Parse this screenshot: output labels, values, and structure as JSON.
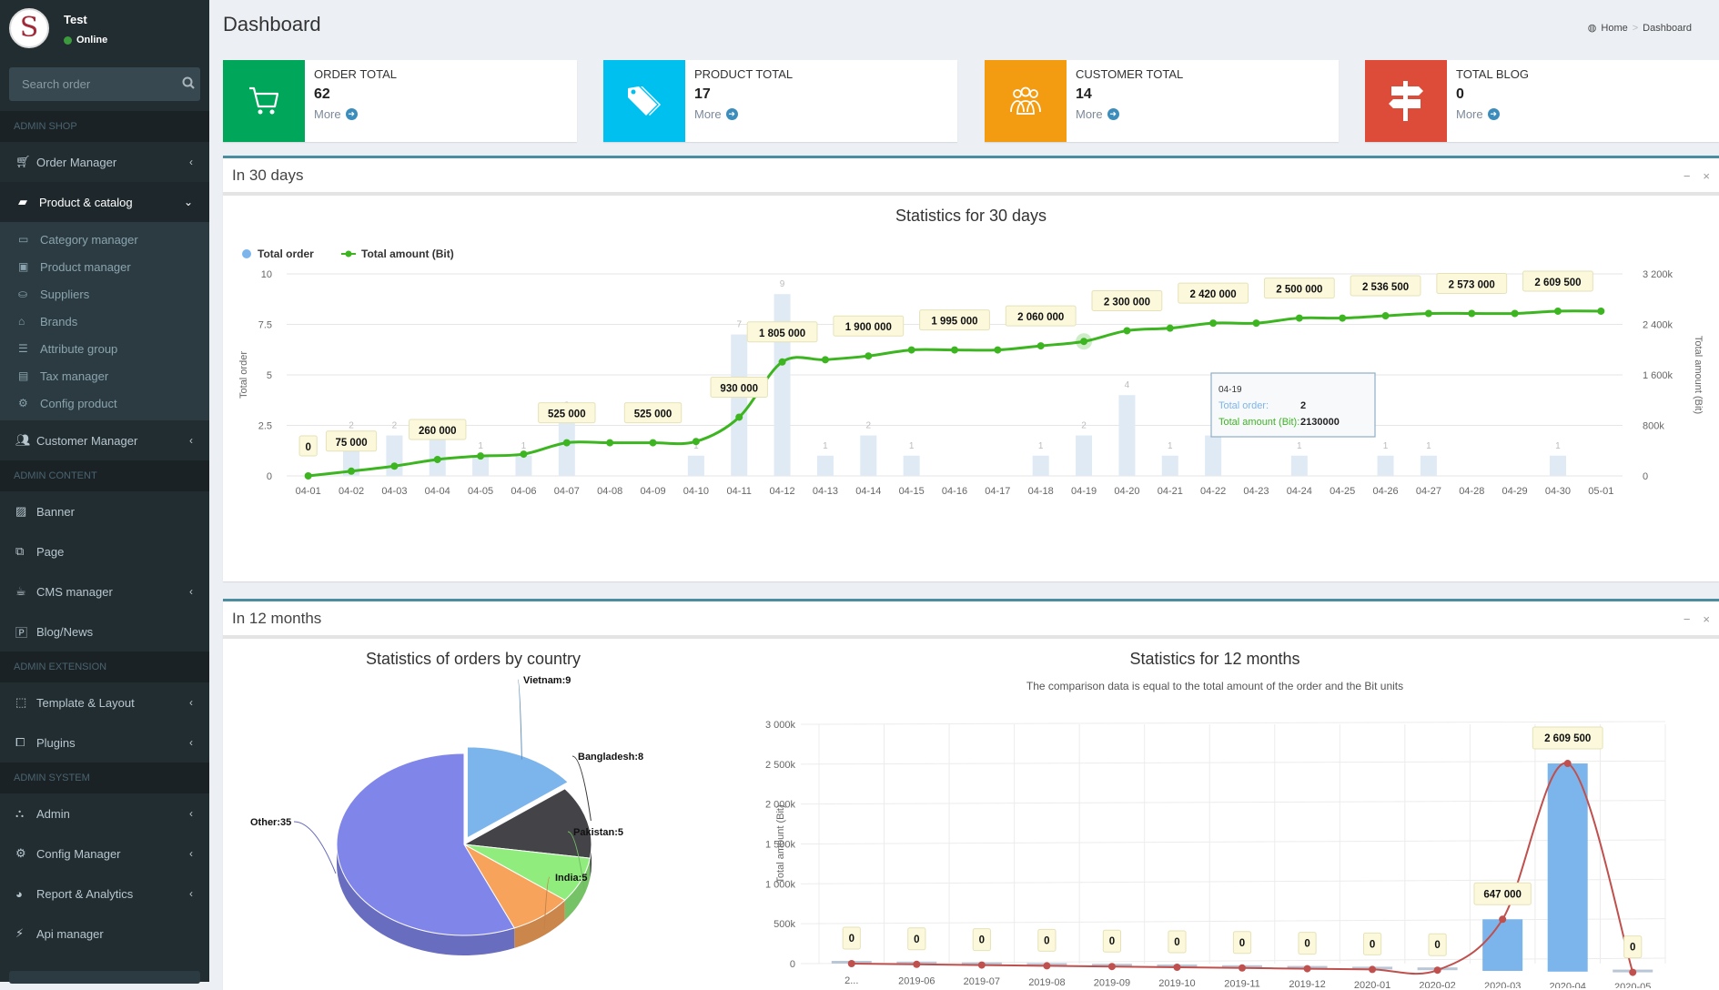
{
  "user": {
    "name": "Test",
    "status": "Online",
    "avatar_letter": "S"
  },
  "search": {
    "placeholder": "Search order",
    "value": ""
  },
  "sidebar": {
    "sections": [
      {
        "header": "ADMIN SHOP",
        "items": [
          {
            "label": "Order Manager",
            "icon": "cart-icon",
            "chevron": "left"
          },
          {
            "label": "Product & catalog",
            "icon": "folder-open-icon",
            "chevron": "down",
            "active": true,
            "children": [
              {
                "label": "Category manager",
                "icon": "folder-outline-icon"
              },
              {
                "label": "Product manager",
                "icon": "image-file-icon"
              },
              {
                "label": "Suppliers",
                "icon": "suppliers-icon"
              },
              {
                "label": "Brands",
                "icon": "bank-icon"
              },
              {
                "label": "Attribute group",
                "icon": "bars-icon"
              },
              {
                "label": "Tax manager",
                "icon": "calendar-minus-icon"
              },
              {
                "label": "Config product",
                "icon": "gear-icon"
              }
            ]
          },
          {
            "label": "Customer Manager",
            "icon": "users-icon",
            "chevron": "left"
          }
        ]
      },
      {
        "header": "ADMIN CONTENT",
        "items": [
          {
            "label": "Banner",
            "icon": "picture-icon"
          },
          {
            "label": "Page",
            "icon": "copy-icon"
          },
          {
            "label": "CMS manager",
            "icon": "coffee-icon",
            "chevron": "left"
          },
          {
            "label": "Blog/News",
            "icon": "file-p-icon"
          }
        ]
      },
      {
        "header": "ADMIN EXTENSION",
        "items": [
          {
            "label": "Template & Layout",
            "icon": "object-group-icon",
            "chevron": "left"
          },
          {
            "label": "Plugins",
            "icon": "puzzle-icon",
            "chevron": "left"
          }
        ]
      },
      {
        "header": "ADMIN SYSTEM",
        "items": [
          {
            "label": "Admin",
            "icon": "sitemap-icon",
            "chevron": "left"
          },
          {
            "label": "Config Manager",
            "icon": "cogs-icon",
            "chevron": "left"
          },
          {
            "label": "Report & Analytics",
            "icon": "pie-chart-icon",
            "chevron": "left"
          },
          {
            "label": "Api manager",
            "icon": "plug-icon"
          }
        ]
      }
    ]
  },
  "header": {
    "title": "Dashboard",
    "breadcrumb": [
      {
        "label": "Home",
        "icon": "dashboard-icon"
      },
      {
        "label": "Dashboard"
      }
    ]
  },
  "info_boxes": [
    {
      "label": "ORDER TOTAL",
      "value": "62",
      "more": "More",
      "color": "#00a65a",
      "icon": "cart-icon"
    },
    {
      "label": "PRODUCT TOTAL",
      "value": "17",
      "more": "More",
      "color": "#00c0ef",
      "icon": "tags-icon"
    },
    {
      "label": "CUSTOMER TOTAL",
      "value": "14",
      "more": "More",
      "color": "#f39c12",
      "icon": "users-icon"
    },
    {
      "label": "TOTAL BLOG",
      "value": "0",
      "more": "More",
      "color": "#dd4b39",
      "icon": "signpost-icon"
    }
  ],
  "box_30days": {
    "title": "In 30 days",
    "minimize": "−",
    "close": "×"
  },
  "box_12months": {
    "title": "In 12 months",
    "minimize": "−",
    "close": "×"
  },
  "chart_data": [
    {
      "type": "bar",
      "title": "Statistics for 30 days",
      "legend": [
        "Total order",
        "Total amount (Bit)"
      ],
      "legend_position": "top-left",
      "ylabel": "Total order",
      "ylabel_right": "Total amount (Bit)",
      "ylim": [
        0,
        10
      ],
      "yticks": [
        "0",
        "2.5",
        "5",
        "7.5",
        "10"
      ],
      "ylim_right": [
        0,
        3200000
      ],
      "yticks_right": [
        "0",
        "800k",
        "1 600k",
        "2 400k",
        "3 200k"
      ],
      "categories": [
        "04-01",
        "04-02",
        "04-03",
        "04-04",
        "04-05",
        "04-06",
        "04-07",
        "04-08",
        "04-09",
        "04-10",
        "04-11",
        "04-12",
        "04-13",
        "04-14",
        "04-15",
        "04-16",
        "04-17",
        "04-18",
        "04-19",
        "04-20",
        "04-21",
        "04-22",
        "04-23",
        "04-24",
        "04-25",
        "04-26",
        "04-27",
        "04-28",
        "04-29",
        "04-30",
        "05-01"
      ],
      "series": [
        {
          "name": "Total order",
          "type": "bar",
          "color": "#dfeaf5",
          "values": [
            0,
            2,
            2,
            2,
            1,
            1,
            3,
            0,
            0,
            1,
            7,
            9,
            1,
            2,
            1,
            0,
            0,
            1,
            2,
            4,
            1,
            2,
            0,
            1,
            0,
            1,
            1,
            0,
            0,
            1,
            0
          ]
        },
        {
          "name": "Total amount (Bit)",
          "type": "line",
          "color": "#3cb521",
          "values": [
            0,
            75000,
            155000,
            260000,
            315000,
            345000,
            525000,
            525000,
            525000,
            545000,
            930000,
            1805000,
            1840000,
            1900000,
            1995000,
            1995000,
            1995000,
            2060000,
            2130000,
            2300000,
            2340000,
            2420000,
            2420000,
            2500000,
            2500000,
            2536500,
            2573000,
            2573000,
            2573000,
            2609500,
            2609500
          ]
        }
      ],
      "line_labels": [
        {
          "index": 0,
          "text": "0"
        },
        {
          "index": 1,
          "text": "75 000"
        },
        {
          "index": 3,
          "text": "260 000"
        },
        {
          "index": 6,
          "text": "525 000"
        },
        {
          "index": 8,
          "text": "525 000"
        },
        {
          "index": 10,
          "text": "930 000"
        },
        {
          "index": 11,
          "text": "1 805 000"
        },
        {
          "index": 13,
          "text": "1 900 000"
        },
        {
          "index": 15,
          "text": "1 995 000"
        },
        {
          "index": 17,
          "text": "2 060 000"
        },
        {
          "index": 19,
          "text": "2 300 000"
        },
        {
          "index": 21,
          "text": "2 420 000"
        },
        {
          "index": 23,
          "text": "2 500 000"
        },
        {
          "index": 25,
          "text": "2 536 500"
        },
        {
          "index": 27,
          "text": "2 573 000"
        },
        {
          "index": 29,
          "text": "2 609 500"
        }
      ],
      "tooltip": {
        "date": "04-19",
        "order_label": "Total order:",
        "order_value": "2",
        "amount_label": "Total amount (Bit):",
        "amount_value": "2130000"
      }
    },
    {
      "type": "pie",
      "title": "Statistics of orders by country",
      "slices": [
        {
          "label": "Vietnam",
          "value": 9,
          "color": "#7cb5ec"
        },
        {
          "label": "Bangladesh",
          "value": 8,
          "color": "#434348"
        },
        {
          "label": "Pakistan",
          "value": 5,
          "color": "#90ed7d"
        },
        {
          "label": "India",
          "value": 5,
          "color": "#f7a35c"
        },
        {
          "label": "Other",
          "value": 35,
          "color": "#8085e9"
        }
      ]
    },
    {
      "type": "bar",
      "title": "Statistics for 12 months",
      "subtitle": "The comparison data is equal to the total amount of the order and the Bit units",
      "ylabel": "Total amount (Bit)",
      "ylim": [
        0,
        3000000
      ],
      "yticks": [
        "0",
        "500k",
        "1 000k",
        "1 500k",
        "2 000k",
        "2 500k",
        "3 000k"
      ],
      "categories": [
        "2...",
        "2019-06",
        "2019-07",
        "2019-08",
        "2019-09",
        "2019-10",
        "2019-11",
        "2019-12",
        "2020-01",
        "2020-02",
        "2020-03",
        "2020-04",
        "2020-05"
      ],
      "series": [
        {
          "name": "Total amount (Bit)",
          "type": "bar",
          "color": "#7cb5ec",
          "values": [
            0,
            0,
            0,
            0,
            0,
            0,
            0,
            0,
            0,
            0,
            647000,
            2609500,
            0
          ]
        },
        {
          "name": "Total amount (Bit)",
          "type": "line",
          "color": "#c0504d",
          "values": [
            0,
            0,
            0,
            0,
            0,
            0,
            0,
            0,
            0,
            0,
            647000,
            2609500,
            0
          ]
        }
      ],
      "data_labels": [
        "0",
        "0",
        "0",
        "0",
        "0",
        "0",
        "0",
        "0",
        "0",
        "0",
        "647 000",
        "2 609 500",
        "0"
      ]
    }
  ]
}
